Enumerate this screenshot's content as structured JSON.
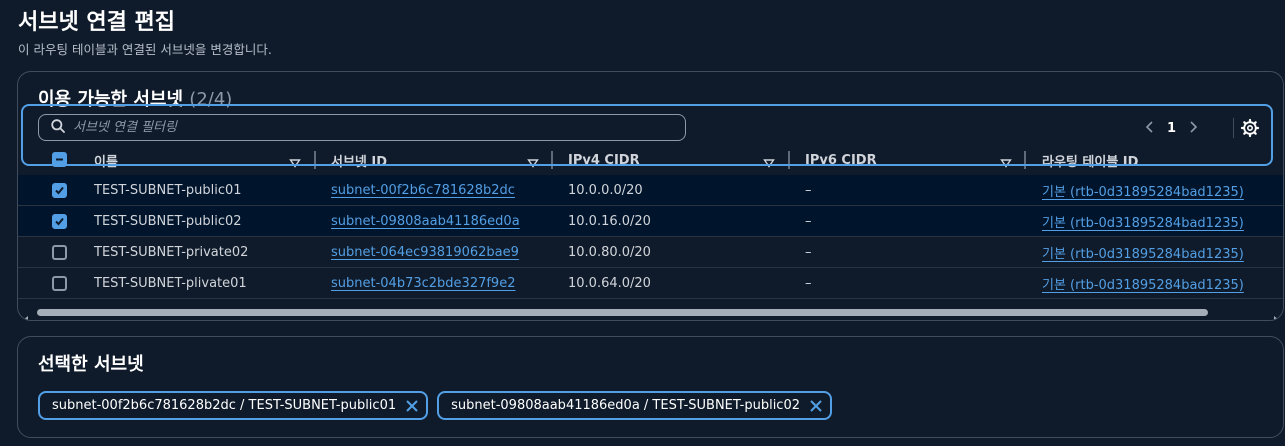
{
  "page": {
    "title": "서브넷 연결 편집",
    "description": "이 라우팅 테이블과 연결된 서브넷을 변경합니다."
  },
  "available": {
    "title": "이용 가능한 서브넷",
    "count": "(2/4)",
    "filter_placeholder": "서브넷 연결 필터링",
    "page_number": "1",
    "columns": [
      "이름",
      "서브넷 ID",
      "IPv4 CIDR",
      "IPv6 CIDR",
      "라우팅 테이블 ID"
    ],
    "rows": [
      {
        "name": "TEST-SUBNET-public01",
        "subnet_id": "subnet-00f2b6c781628b2dc",
        "ipv4": "10.0.0.0/20",
        "ipv6": "–",
        "route_table": "기본 (rtb-0d31895284bad1235)",
        "checked": true
      },
      {
        "name": "TEST-SUBNET-public02",
        "subnet_id": "subnet-09808aab41186ed0a",
        "ipv4": "10.0.16.0/20",
        "ipv6": "–",
        "route_table": "기본 (rtb-0d31895284bad1235)",
        "checked": true
      },
      {
        "name": "TEST-SUBNET-private02",
        "subnet_id": "subnet-064ec93819062bae9",
        "ipv4": "10.0.80.0/20",
        "ipv6": "–",
        "route_table": "기본 (rtb-0d31895284bad1235)",
        "checked": false
      },
      {
        "name": "TEST-SUBNET-plivate01",
        "subnet_id": "subnet-04b73c2bde327f9e2",
        "ipv4": "10.0.64.0/20",
        "ipv6": "–",
        "route_table": "기본 (rtb-0d31895284bad1235)",
        "checked": false
      }
    ]
  },
  "selected": {
    "title": "선택한 서브넷",
    "tokens": [
      "subnet-00f2b6c781628b2dc / TEST-SUBNET-public01",
      "subnet-09808aab41186ed0a / TEST-SUBNET-public02"
    ]
  },
  "colors": {
    "background": "#0f1b2a",
    "accent": "#539fe5",
    "border": "#414d5c"
  },
  "icons": [
    "search-icon",
    "chevron-left-icon",
    "chevron-right-icon",
    "gear-icon",
    "sort-icon",
    "close-icon",
    "check-icon"
  ]
}
